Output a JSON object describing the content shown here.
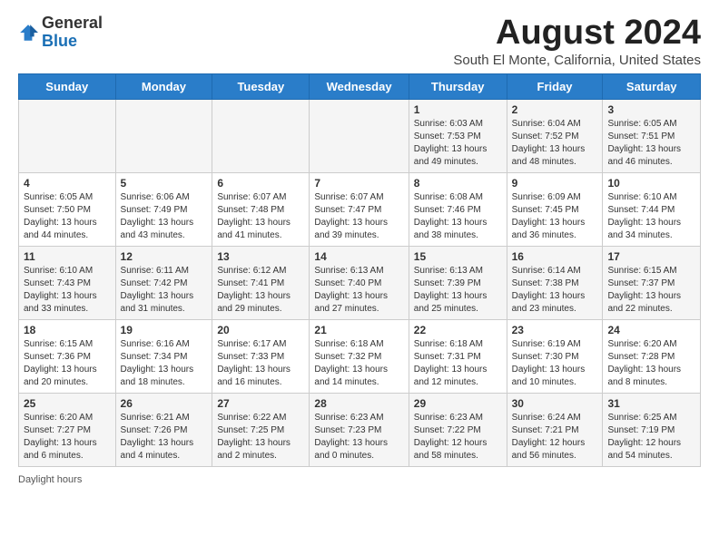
{
  "logo": {
    "general": "General",
    "blue": "Blue"
  },
  "title": "August 2024",
  "subtitle": "South El Monte, California, United States",
  "headers": [
    "Sunday",
    "Monday",
    "Tuesday",
    "Wednesday",
    "Thursday",
    "Friday",
    "Saturday"
  ],
  "weeks": [
    [
      {
        "day": "",
        "info": ""
      },
      {
        "day": "",
        "info": ""
      },
      {
        "day": "",
        "info": ""
      },
      {
        "day": "",
        "info": ""
      },
      {
        "day": "1",
        "info": "Sunrise: 6:03 AM\nSunset: 7:53 PM\nDaylight: 13 hours\nand 49 minutes."
      },
      {
        "day": "2",
        "info": "Sunrise: 6:04 AM\nSunset: 7:52 PM\nDaylight: 13 hours\nand 48 minutes."
      },
      {
        "day": "3",
        "info": "Sunrise: 6:05 AM\nSunset: 7:51 PM\nDaylight: 13 hours\nand 46 minutes."
      }
    ],
    [
      {
        "day": "4",
        "info": "Sunrise: 6:05 AM\nSunset: 7:50 PM\nDaylight: 13 hours\nand 44 minutes."
      },
      {
        "day": "5",
        "info": "Sunrise: 6:06 AM\nSunset: 7:49 PM\nDaylight: 13 hours\nand 43 minutes."
      },
      {
        "day": "6",
        "info": "Sunrise: 6:07 AM\nSunset: 7:48 PM\nDaylight: 13 hours\nand 41 minutes."
      },
      {
        "day": "7",
        "info": "Sunrise: 6:07 AM\nSunset: 7:47 PM\nDaylight: 13 hours\nand 39 minutes."
      },
      {
        "day": "8",
        "info": "Sunrise: 6:08 AM\nSunset: 7:46 PM\nDaylight: 13 hours\nand 38 minutes."
      },
      {
        "day": "9",
        "info": "Sunrise: 6:09 AM\nSunset: 7:45 PM\nDaylight: 13 hours\nand 36 minutes."
      },
      {
        "day": "10",
        "info": "Sunrise: 6:10 AM\nSunset: 7:44 PM\nDaylight: 13 hours\nand 34 minutes."
      }
    ],
    [
      {
        "day": "11",
        "info": "Sunrise: 6:10 AM\nSunset: 7:43 PM\nDaylight: 13 hours\nand 33 minutes."
      },
      {
        "day": "12",
        "info": "Sunrise: 6:11 AM\nSunset: 7:42 PM\nDaylight: 13 hours\nand 31 minutes."
      },
      {
        "day": "13",
        "info": "Sunrise: 6:12 AM\nSunset: 7:41 PM\nDaylight: 13 hours\nand 29 minutes."
      },
      {
        "day": "14",
        "info": "Sunrise: 6:13 AM\nSunset: 7:40 PM\nDaylight: 13 hours\nand 27 minutes."
      },
      {
        "day": "15",
        "info": "Sunrise: 6:13 AM\nSunset: 7:39 PM\nDaylight: 13 hours\nand 25 minutes."
      },
      {
        "day": "16",
        "info": "Sunrise: 6:14 AM\nSunset: 7:38 PM\nDaylight: 13 hours\nand 23 minutes."
      },
      {
        "day": "17",
        "info": "Sunrise: 6:15 AM\nSunset: 7:37 PM\nDaylight: 13 hours\nand 22 minutes."
      }
    ],
    [
      {
        "day": "18",
        "info": "Sunrise: 6:15 AM\nSunset: 7:36 PM\nDaylight: 13 hours\nand 20 minutes."
      },
      {
        "day": "19",
        "info": "Sunrise: 6:16 AM\nSunset: 7:34 PM\nDaylight: 13 hours\nand 18 minutes."
      },
      {
        "day": "20",
        "info": "Sunrise: 6:17 AM\nSunset: 7:33 PM\nDaylight: 13 hours\nand 16 minutes."
      },
      {
        "day": "21",
        "info": "Sunrise: 6:18 AM\nSunset: 7:32 PM\nDaylight: 13 hours\nand 14 minutes."
      },
      {
        "day": "22",
        "info": "Sunrise: 6:18 AM\nSunset: 7:31 PM\nDaylight: 13 hours\nand 12 minutes."
      },
      {
        "day": "23",
        "info": "Sunrise: 6:19 AM\nSunset: 7:30 PM\nDaylight: 13 hours\nand 10 minutes."
      },
      {
        "day": "24",
        "info": "Sunrise: 6:20 AM\nSunset: 7:28 PM\nDaylight: 13 hours\nand 8 minutes."
      }
    ],
    [
      {
        "day": "25",
        "info": "Sunrise: 6:20 AM\nSunset: 7:27 PM\nDaylight: 13 hours\nand 6 minutes."
      },
      {
        "day": "26",
        "info": "Sunrise: 6:21 AM\nSunset: 7:26 PM\nDaylight: 13 hours\nand 4 minutes."
      },
      {
        "day": "27",
        "info": "Sunrise: 6:22 AM\nSunset: 7:25 PM\nDaylight: 13 hours\nand 2 minutes."
      },
      {
        "day": "28",
        "info": "Sunrise: 6:23 AM\nSunset: 7:23 PM\nDaylight: 13 hours\nand 0 minutes."
      },
      {
        "day": "29",
        "info": "Sunrise: 6:23 AM\nSunset: 7:22 PM\nDaylight: 12 hours\nand 58 minutes."
      },
      {
        "day": "30",
        "info": "Sunrise: 6:24 AM\nSunset: 7:21 PM\nDaylight: 12 hours\nand 56 minutes."
      },
      {
        "day": "31",
        "info": "Sunrise: 6:25 AM\nSunset: 7:19 PM\nDaylight: 12 hours\nand 54 minutes."
      }
    ]
  ],
  "footer": "Daylight hours"
}
